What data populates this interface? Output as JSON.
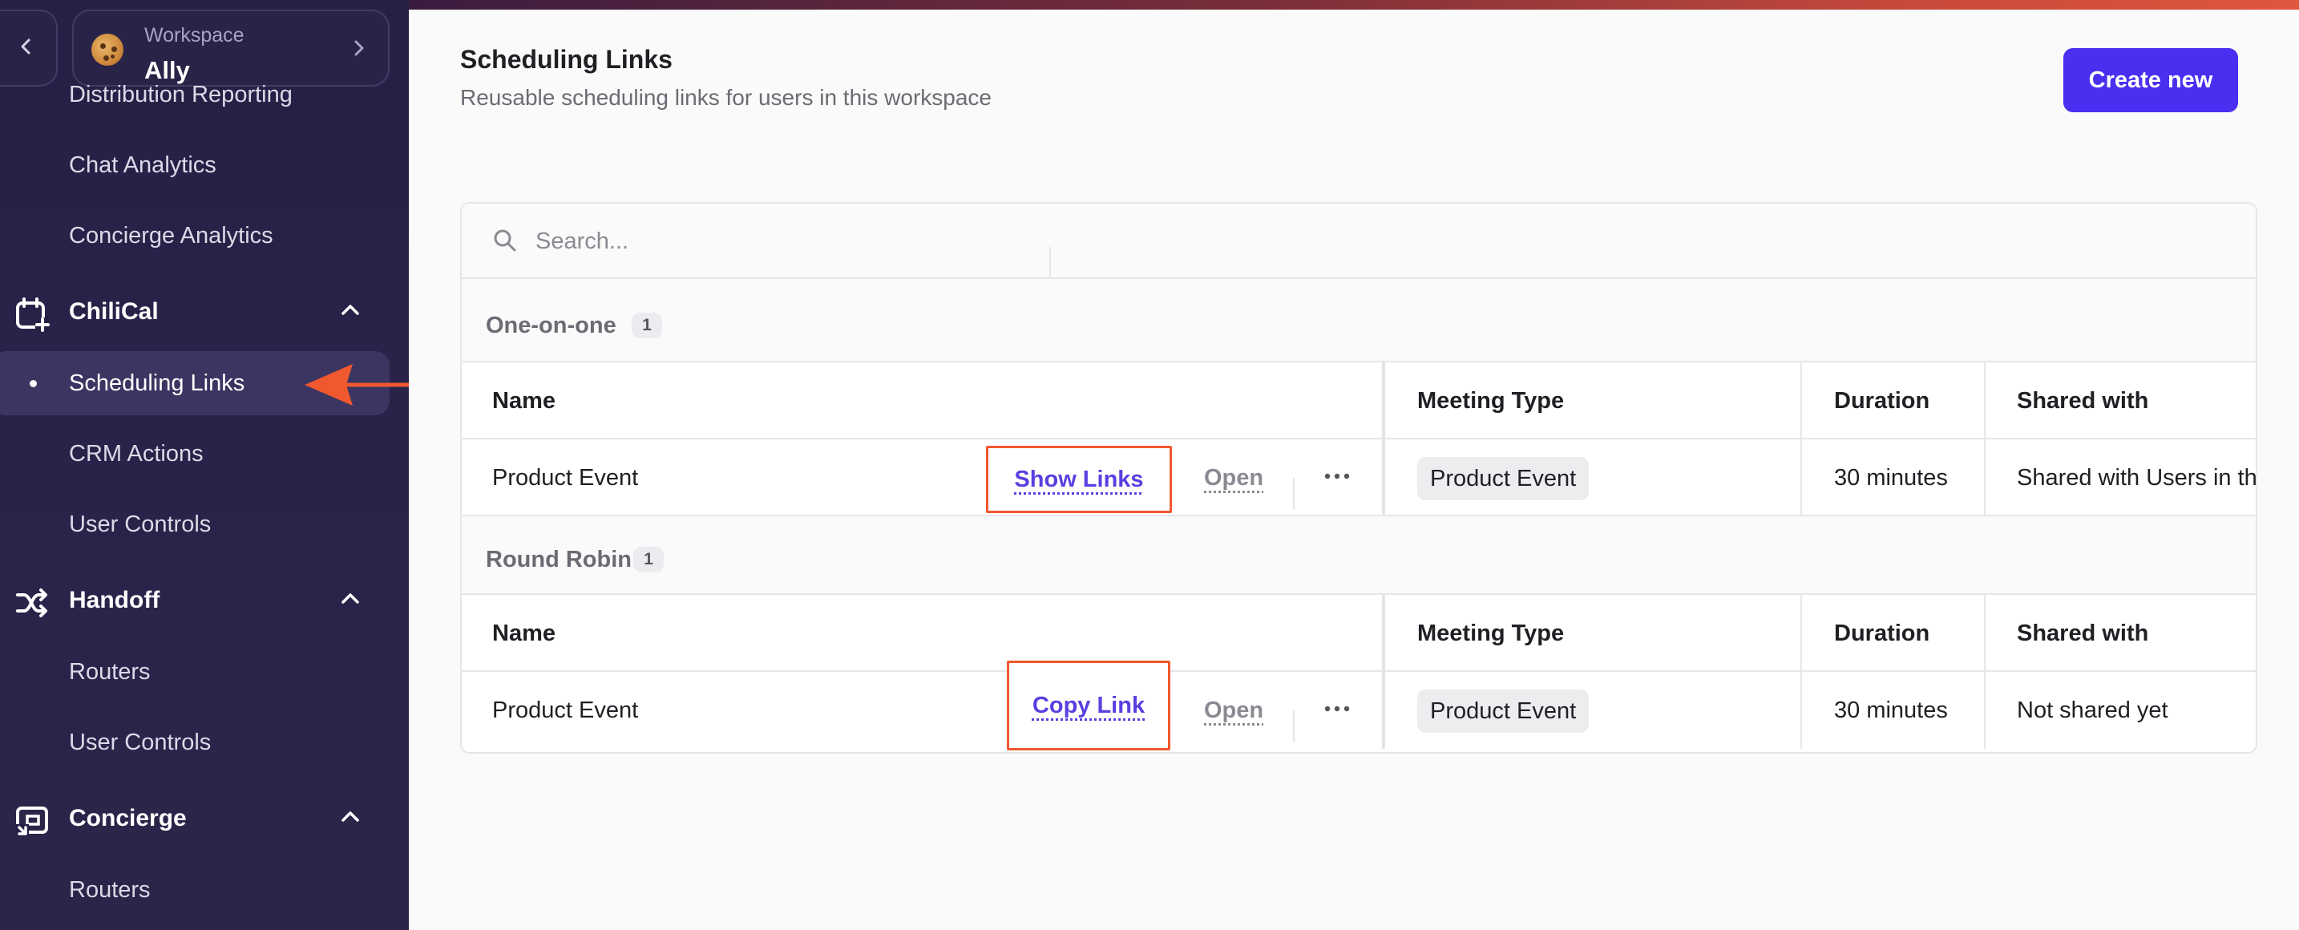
{
  "colors": {
    "sidebar_bg": "#262045",
    "accent": "#4a2ff0",
    "link": "#5a3fe0",
    "highlight_box": "#f0582f"
  },
  "workspace": {
    "label": "Workspace",
    "name": "Ally"
  },
  "sidebar": {
    "items": [
      {
        "label": "Distribution Reporting"
      },
      {
        "label": "Chat Analytics"
      },
      {
        "label": "Concierge Analytics"
      }
    ],
    "sections": [
      {
        "label": "ChiliCal",
        "icon": "calendar-plus-icon",
        "items": [
          {
            "label": "Scheduling Links",
            "active": true
          },
          {
            "label": "CRM Actions"
          },
          {
            "label": "User Controls"
          }
        ]
      },
      {
        "label": "Handoff",
        "icon": "shuffle-icon",
        "items": [
          {
            "label": "Routers"
          },
          {
            "label": "User Controls"
          }
        ]
      },
      {
        "label": "Concierge",
        "icon": "concierge-icon",
        "items": [
          {
            "label": "Routers"
          }
        ]
      }
    ]
  },
  "main": {
    "title": "Scheduling Links",
    "subtitle": "Reusable scheduling links for users in this workspace",
    "create_button": "Create new",
    "search_placeholder": "Search...",
    "groups": [
      {
        "name": "One-on-one",
        "count": "1",
        "columns": [
          "Name",
          "Meeting Type",
          "Duration",
          "Shared with"
        ],
        "rows": [
          {
            "name": "Product Event",
            "primary_action": "Show Links",
            "open_action": "Open",
            "meeting_type": "Product Event",
            "duration": "30 minutes",
            "shared_with": "Shared with Users in th"
          }
        ]
      },
      {
        "name": "Round Robin",
        "count": "1",
        "columns": [
          "Name",
          "Meeting Type",
          "Duration",
          "Shared with"
        ],
        "rows": [
          {
            "name": "Product Event",
            "primary_action": "Copy Link",
            "open_action": "Open",
            "meeting_type": "Product Event",
            "duration": "30 minutes",
            "shared_with": "Not shared yet"
          }
        ]
      }
    ]
  }
}
